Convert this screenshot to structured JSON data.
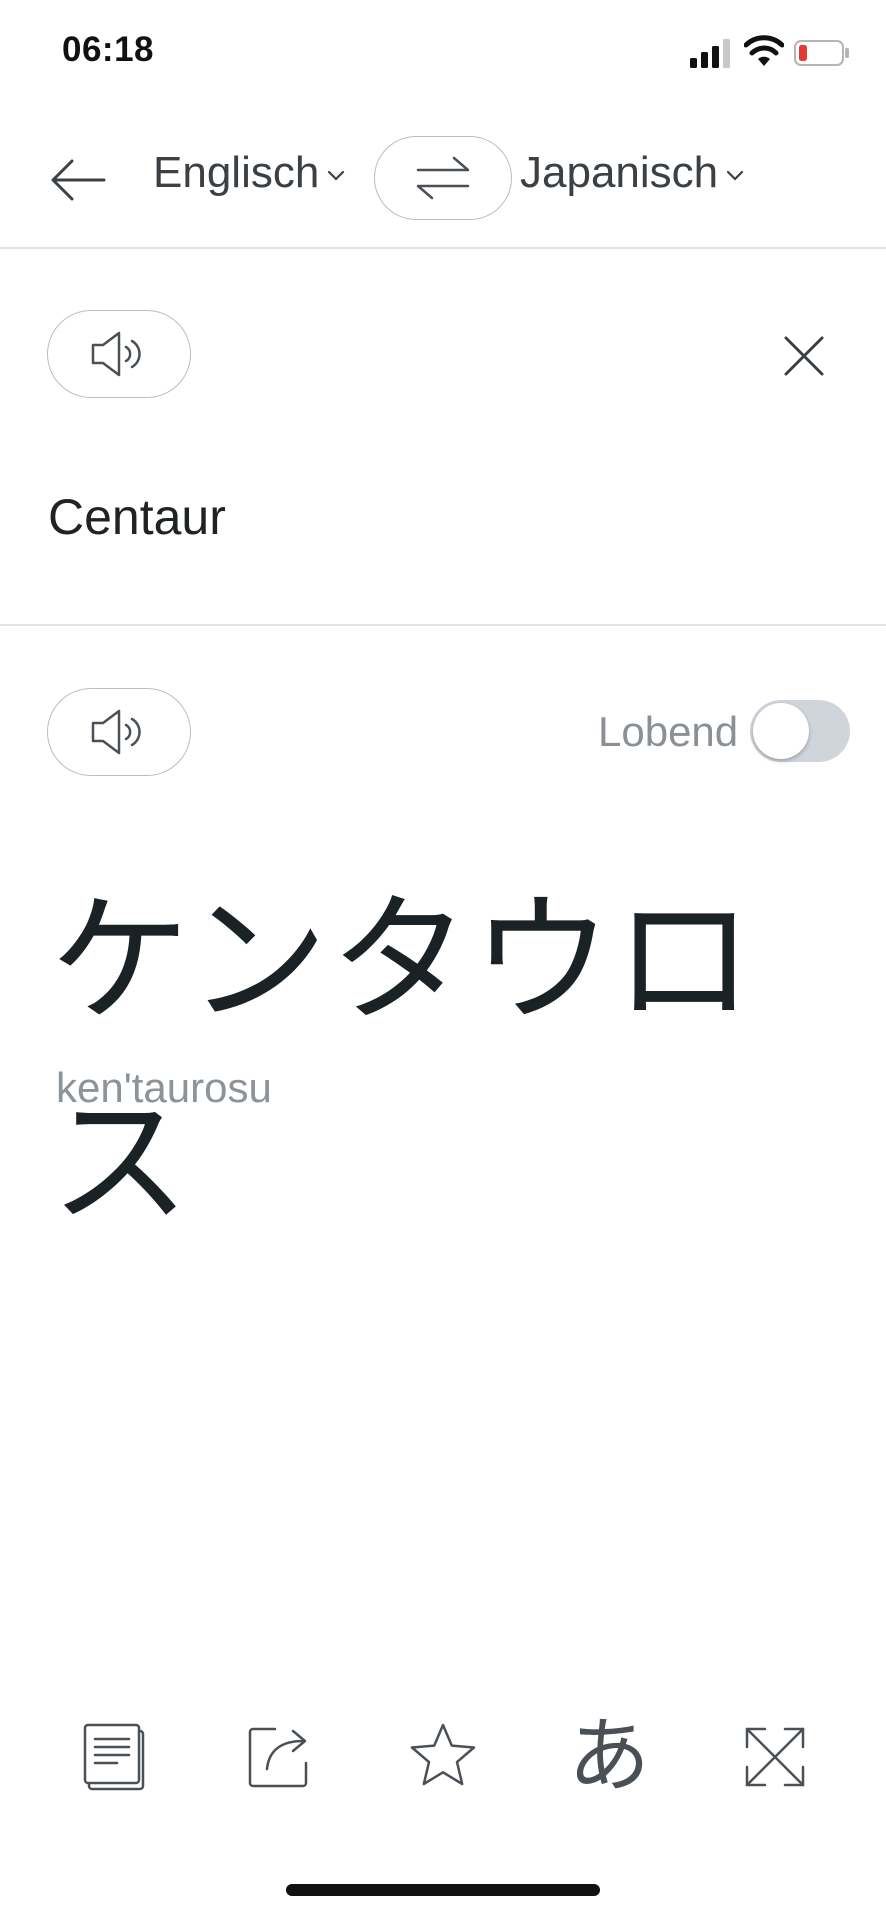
{
  "status": {
    "time": "06:18"
  },
  "header": {
    "source_language": "Englisch",
    "target_language": "Japanisch"
  },
  "source": {
    "text": "Centaur"
  },
  "target": {
    "formal_label": "Lobend",
    "formal_enabled": false,
    "text": "ケンタウロス",
    "romanization": "ken'taurosu"
  },
  "toolbar": {
    "hiragana_label": "あ"
  },
  "colors": {
    "divider": "#dfe3e6",
    "toggle_off": "#cfd5da",
    "battery_low": "#e53935"
  }
}
